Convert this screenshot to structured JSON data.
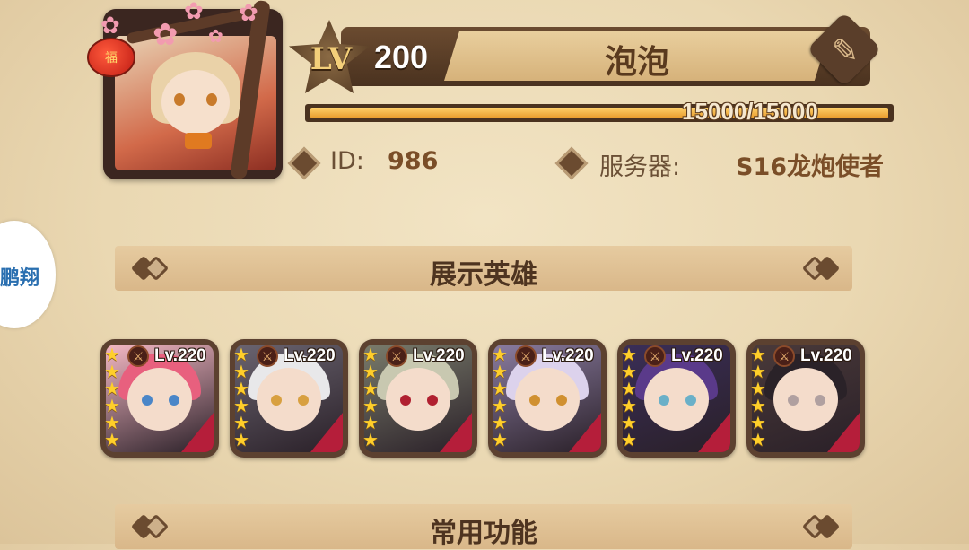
{
  "profile": {
    "avatar_icon": "character-portrait",
    "lantern_char": "福",
    "level_prefix": "LV",
    "level": "200",
    "name": "泡泡",
    "exp_text": "15000/15000",
    "exp_fraction": 1.0,
    "id_label": "ID:",
    "id_value": "986",
    "server_label": "服务器:",
    "server_value": "S16龙炮使者"
  },
  "watermark": {
    "text": "鹏翔"
  },
  "sections": {
    "heroes_title": "展示英雄",
    "functions_title": "常用功能"
  },
  "heroes": [
    {
      "level": "Lv.220",
      "stars": 6,
      "hair": "#e8607e",
      "bg": "#f4b8c4",
      "eye": "#4a86c8"
    },
    {
      "level": "Lv.220",
      "stars": 6,
      "hair": "#e8e8ea",
      "bg": "#6a6470",
      "eye": "#d8a040"
    },
    {
      "level": "Lv.220",
      "stars": 6,
      "hair": "#c8c8b0",
      "bg": "#7a7c6c",
      "eye": "#b02030"
    },
    {
      "level": "Lv.220",
      "stars": 6,
      "hair": "#dcd2ec",
      "bg": "#8a7ca0",
      "eye": "#d09030"
    },
    {
      "level": "Lv.220",
      "stars": 6,
      "hair": "#5a3a8a",
      "bg": "#3a2e58",
      "eye": "#6ab0c8"
    },
    {
      "level": "Lv.220",
      "stars": 6,
      "hair": "#2a2228",
      "bg": "#4a3a3a",
      "eye": "#b0a0a0"
    }
  ],
  "colors": {
    "accent": "#7a4e28",
    "card_stripe": "#b51e3a",
    "star": "#ffcf2a"
  }
}
